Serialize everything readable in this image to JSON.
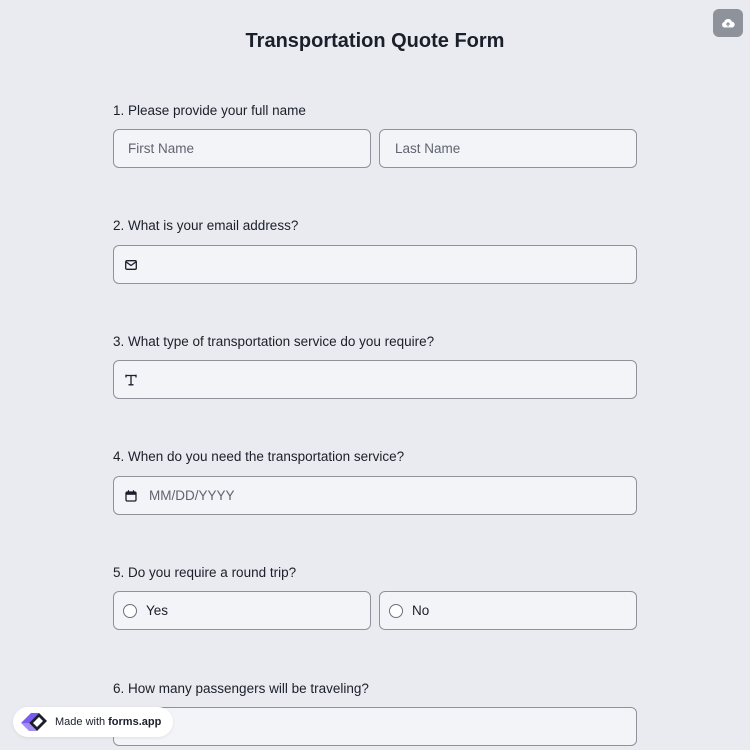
{
  "form": {
    "title": "Transportation Quote Form"
  },
  "questions": {
    "q1": {
      "label": "1.  Please provide your full name",
      "first_name_placeholder": "First Name",
      "last_name_placeholder": "Last Name"
    },
    "q2": {
      "label": "2. What is your email address?",
      "icon": "mail-icon"
    },
    "q3": {
      "label": "3. What type of transportation service do you require?",
      "icon": "text-icon"
    },
    "q4": {
      "label": "4. When do you need the transportation service?",
      "placeholder": "MM/DD/YYYY",
      "icon": "calendar-icon"
    },
    "q5": {
      "label": "5. Do you require a round trip?",
      "options": [
        "Yes",
        "No"
      ]
    },
    "q6": {
      "label": "6. How many passengers will be traveling?"
    }
  },
  "badge": {
    "prefix": "Made with",
    "brand": "forms.app"
  },
  "toolbar": {
    "upload_icon": "cloud-upload-icon"
  },
  "colors": {
    "background": "#e9ebf1",
    "field_background": "#f3f4f8",
    "field_border": "#8e929b",
    "upload_button": "#8d929b",
    "brand_purple": "#7b5cf0"
  }
}
